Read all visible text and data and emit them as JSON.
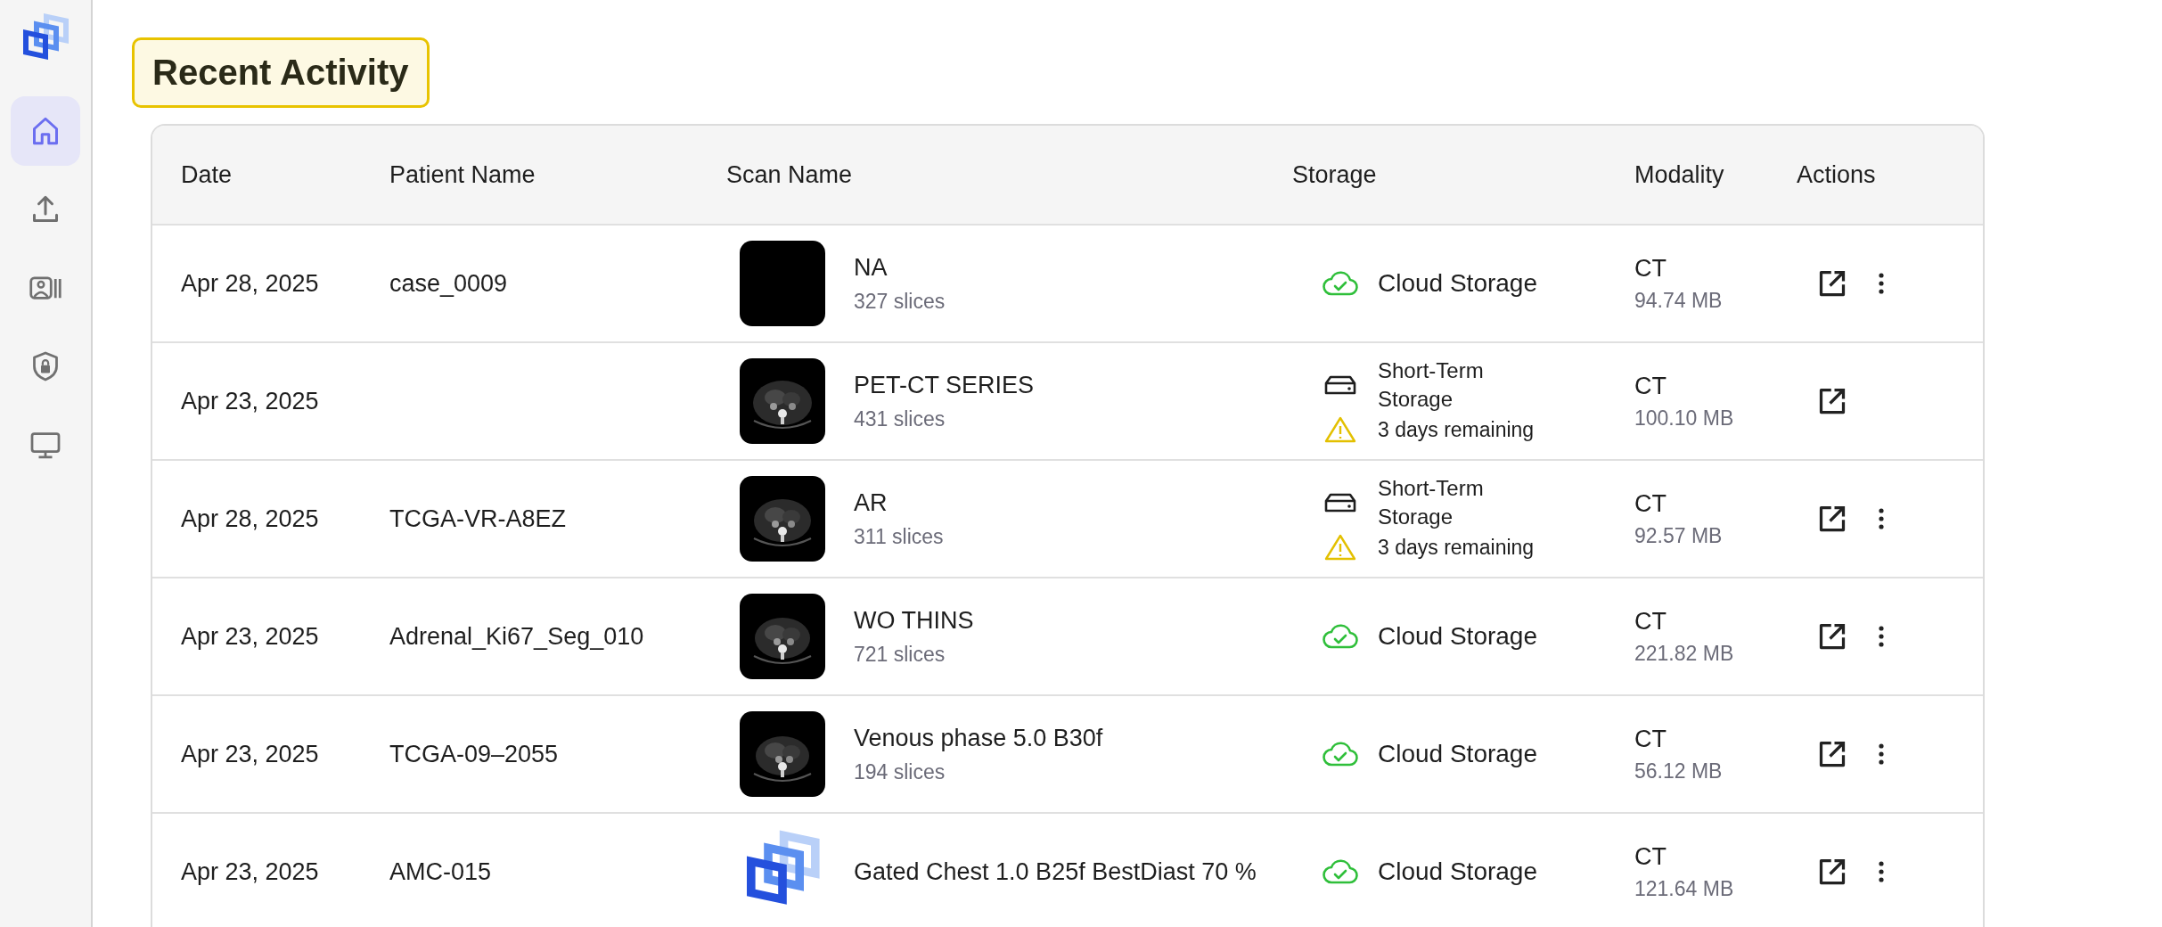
{
  "sidebar": {
    "items": [
      {
        "selected": true
      },
      {
        "selected": false
      },
      {
        "selected": false
      },
      {
        "selected": false
      },
      {
        "selected": false
      }
    ]
  },
  "title": "Recent Activity",
  "table": {
    "columns": [
      "Date",
      "Patient Name",
      "Scan Name",
      "Storage",
      "Modality",
      "Actions"
    ],
    "rows": [
      {
        "date": "Apr 28, 2025",
        "patient": "case_0009",
        "thumbnail": {
          "kind": "blank"
        },
        "scan": "NA",
        "slices": "327 slices",
        "storage": {
          "kind": "cloud",
          "label": "Cloud Storage"
        },
        "modality": "CT",
        "size": "94.74 MB",
        "more_menu": true
      },
      {
        "date": "Apr 23, 2025",
        "scan": "PET-CT SERIES",
        "slices": "431 slices",
        "storage": {
          "kind": "short_term",
          "label": "Short-Term Storage",
          "warning": "3 days remaining"
        },
        "modality": "CT",
        "size": "100.10 MB",
        "more_menu": false
      },
      {
        "date": "Apr 28, 2025",
        "patient": "TCGA-VR-A8EZ",
        "scan": "AR",
        "slices": "311 slices",
        "storage": {
          "kind": "short_term",
          "label": "Short-Term Storage",
          "warning": "3 days remaining"
        },
        "modality": "CT",
        "size": "92.57 MB",
        "more_menu": true
      },
      {
        "date": "Apr 23, 2025",
        "patient": "Adrenal_Ki67_Seg_010",
        "scan": "WO THINS",
        "slices": "721 slices",
        "storage": {
          "kind": "cloud",
          "label": "Cloud Storage"
        },
        "modality": "CT",
        "size": "221.82 MB",
        "more_menu": true
      },
      {
        "date": "Apr 23, 2025",
        "patient": "TCGA-09–2055",
        "scan": "Venous phase 5.0 B30f",
        "slices": "194 slices",
        "storage": {
          "kind": "cloud",
          "label": "Cloud Storage"
        },
        "modality": "CT",
        "size": "56.12 MB",
        "more_menu": true
      },
      {
        "date": "Apr 23, 2025",
        "patient": "AMC-015",
        "thumbnail": {
          "kind": "logo"
        },
        "scan": "Gated Chest 1.0 B25f BestDiast 70 %",
        "storage": {
          "kind": "cloud",
          "label": "Cloud Storage"
        },
        "modality": "CT",
        "size": "121.64 MB",
        "more_menu": true
      }
    ]
  }
}
